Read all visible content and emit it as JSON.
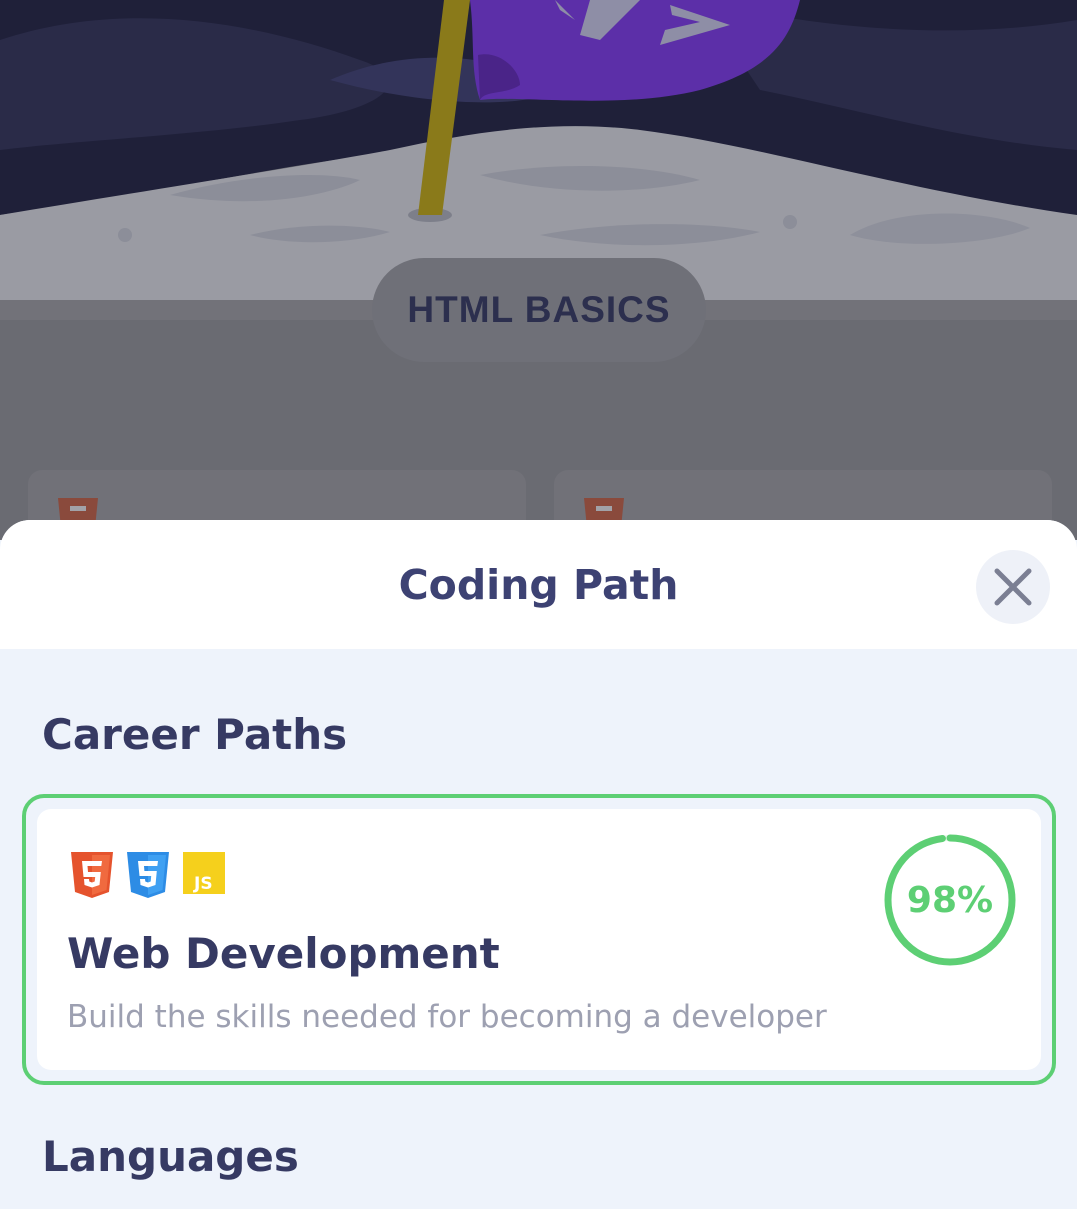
{
  "background": {
    "course_title": "HTML BASICS"
  },
  "sheet": {
    "title": "Coding Path",
    "sections": {
      "career_paths": "Career Paths",
      "languages": "Languages"
    },
    "career_path": {
      "name": "Web Development",
      "description": "Build the skills needed for becoming a developer",
      "progress_percent": 98,
      "progress_label": "98%",
      "icons": [
        "html5-icon",
        "css3-icon",
        "javascript-icon"
      ]
    }
  },
  "colors": {
    "accent_green": "#5dcf74",
    "title_navy": "#3d4273",
    "html_orange": "#e5532d",
    "css_blue": "#2d8ce5",
    "js_yellow": "#f5d01c",
    "flag_purple": "#5c2fa8"
  }
}
